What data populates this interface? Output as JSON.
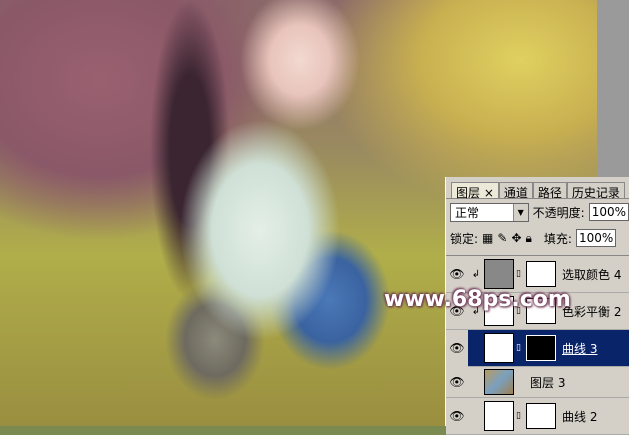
{
  "tabs": [
    "图层 ×",
    "通道",
    "路径",
    "历史记录"
  ],
  "blend_mode": "正常",
  "opacity_label": "不透明度:",
  "opacity": "100%",
  "lock_label": "锁定:",
  "fill_label": "填充:",
  "fill": "100%",
  "layers": [
    {
      "name": "选取颜色 4",
      "clipped": true,
      "selected": false
    },
    {
      "name": "色彩平衡 2",
      "clipped": true,
      "selected": false
    },
    {
      "name": "曲线 3",
      "clipped": false,
      "selected": true
    },
    {
      "name": "图层 3",
      "clipped": false,
      "selected": false
    },
    {
      "name": "曲线 2",
      "clipped": false,
      "selected": false
    }
  ],
  "watermark": "www.68ps.com"
}
